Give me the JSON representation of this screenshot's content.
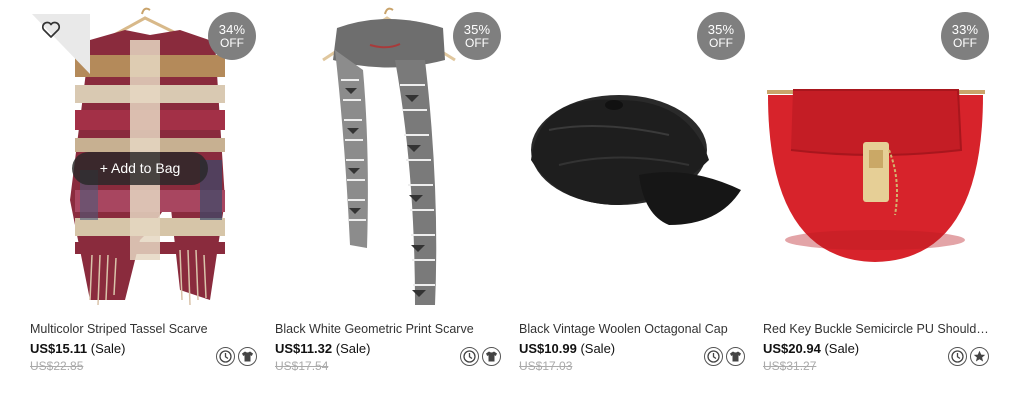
{
  "products": [
    {
      "title": "Multicolor Striped Tassel Scarve",
      "price": "US$15.11",
      "sale_label": "(Sale)",
      "old_price": "US$22.85",
      "discount_pct": "34%",
      "discount_off": "OFF",
      "add_to_bag": "+ Add to Bag",
      "icons": [
        "clock-icon",
        "shirt-icon"
      ]
    },
    {
      "title": "Black White Geometric Print Scarve",
      "price": "US$11.32",
      "sale_label": "(Sale)",
      "old_price": "US$17.54",
      "discount_pct": "35%",
      "discount_off": "OFF",
      "icons": [
        "clock-icon",
        "shirt-icon"
      ]
    },
    {
      "title": "Black Vintage Woolen Octagonal Cap",
      "price": "US$10.99",
      "sale_label": "(Sale)",
      "old_price": "US$17.03",
      "discount_pct": "35%",
      "discount_off": "OFF",
      "icons": [
        "clock-icon",
        "shirt-icon"
      ]
    },
    {
      "title": "Red Key Buckle Semicircle PU Shoulder...",
      "price": "US$20.94",
      "sale_label": "(Sale)",
      "old_price": "US$31.27",
      "discount_pct": "33%",
      "discount_off": "OFF",
      "icons": [
        "clock-icon",
        "star-icon"
      ]
    }
  ],
  "colors": {
    "badge": "#7f7f7f",
    "add_to_bag_bg": "#282828",
    "old_price": "#aaaaaa"
  }
}
